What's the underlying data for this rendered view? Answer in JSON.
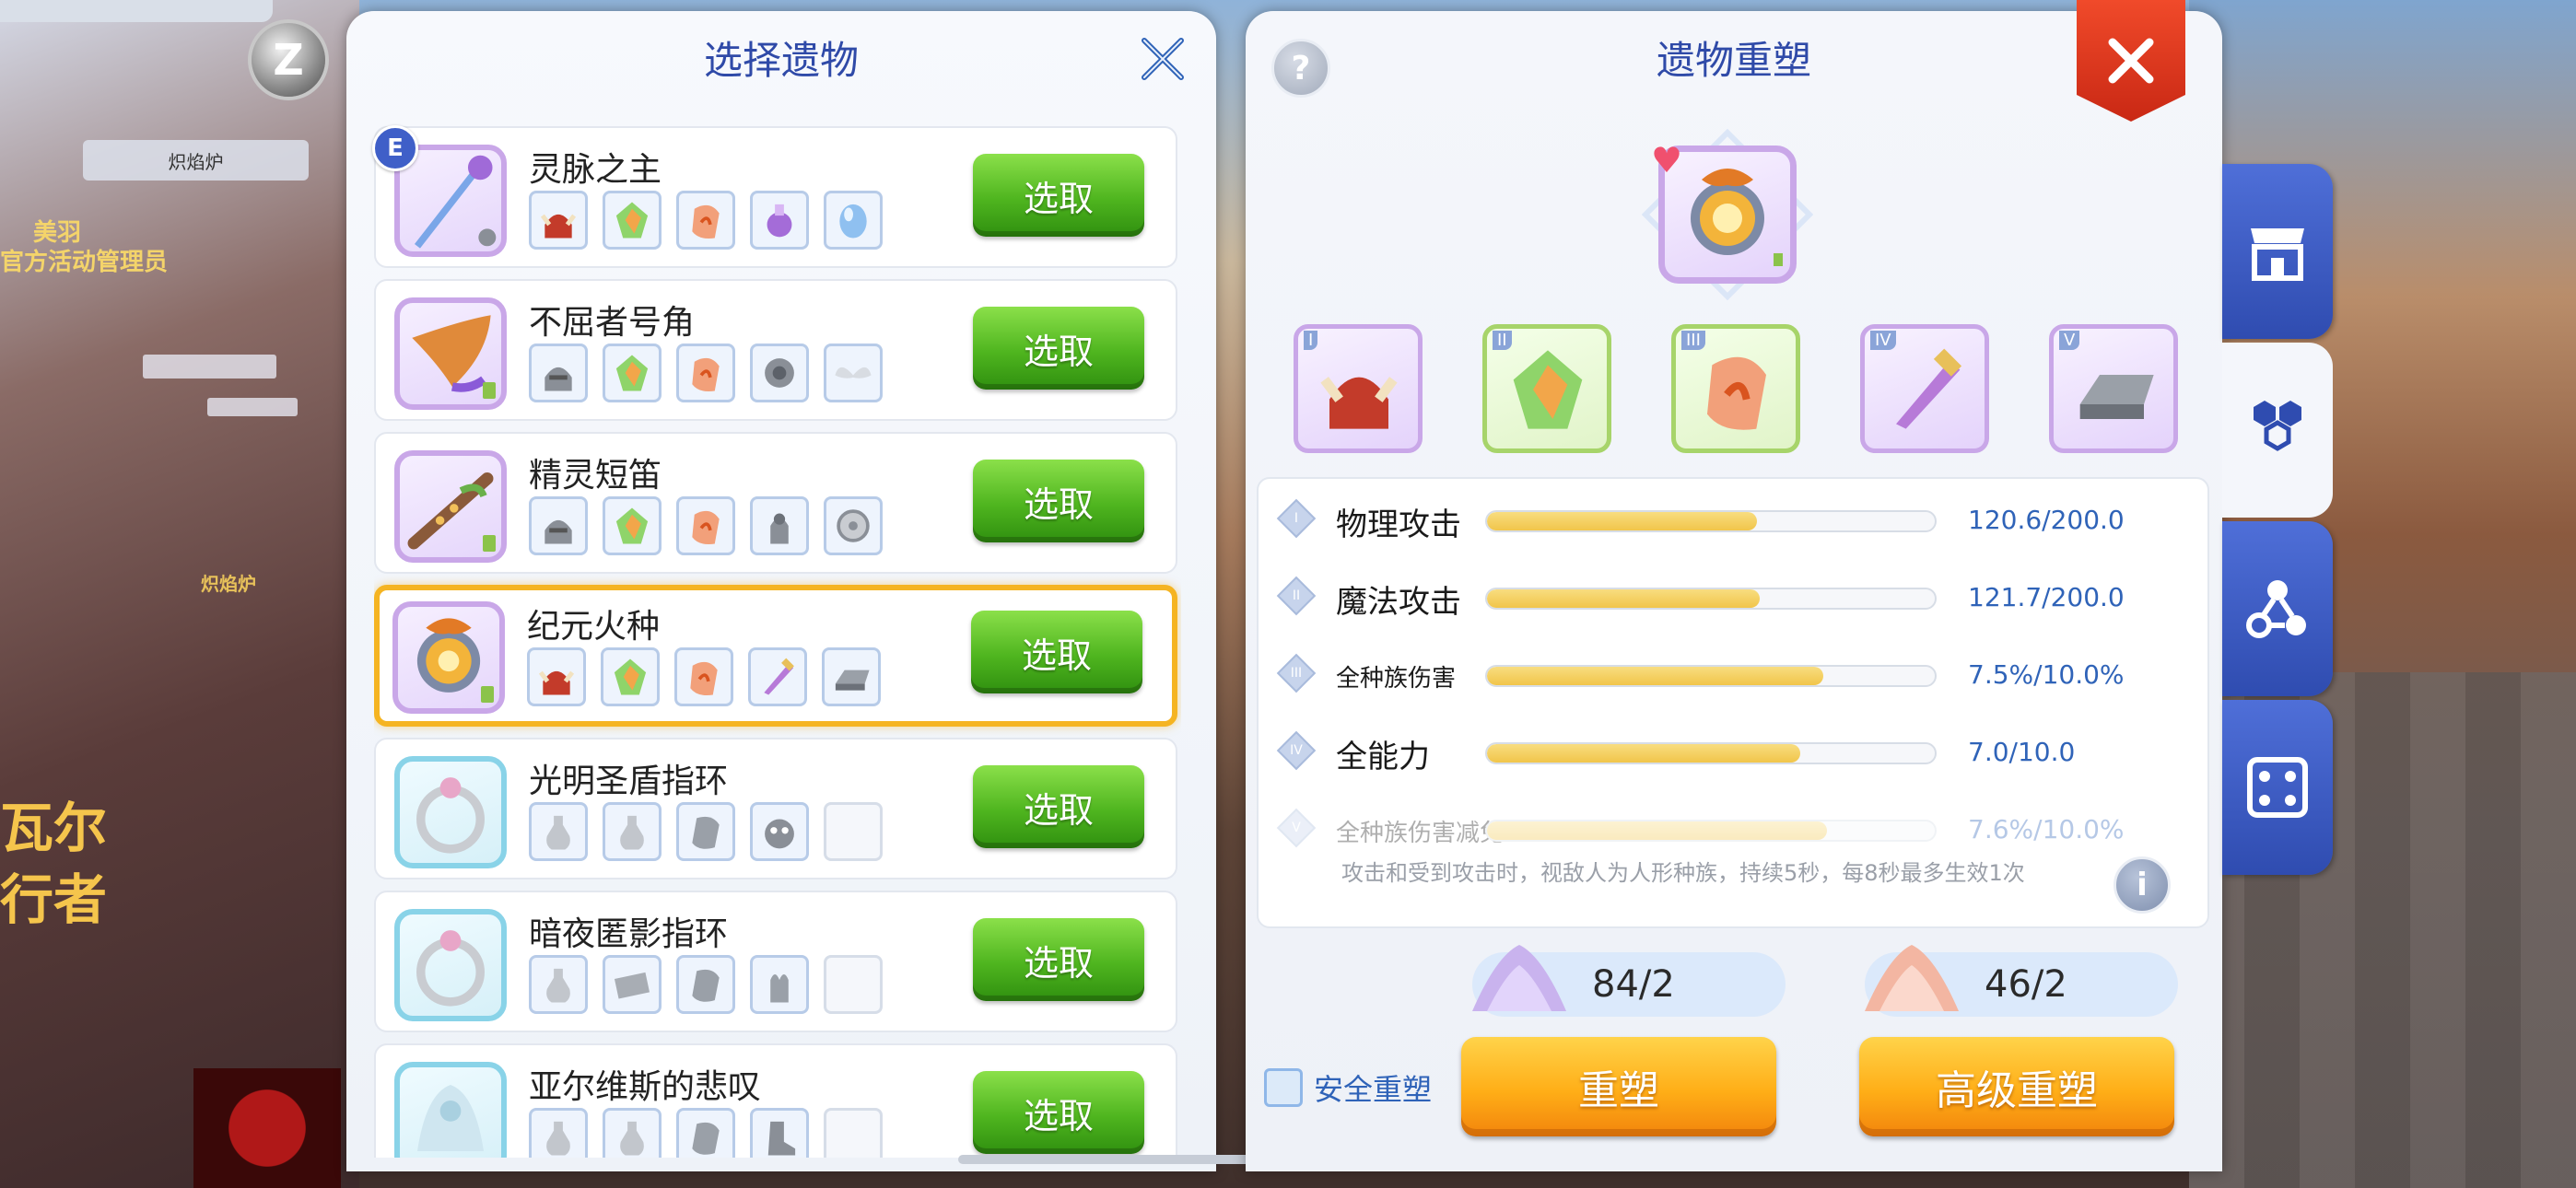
{
  "background": {
    "npc_sign": "炽焰炉",
    "npc_title": "美羽",
    "npc_role": "官方活动管理员",
    "ground_label": "炽焰炉",
    "edge_text_1": "瓦尔",
    "edge_text_2": "行者",
    "z_button": "Z"
  },
  "left_panel": {
    "title": "选择遗物",
    "equip_badge": "E",
    "pick_label": "选取",
    "items": [
      {
        "name": "灵脉之主",
        "icon": "spirit-staff-icon",
        "frame": "purple",
        "selected": false,
        "slots": [
          "red-helm-icon",
          "green-crystal-icon",
          "orange-stone-icon",
          "purple-potion-icon",
          "blue-orb-icon"
        ]
      },
      {
        "name": "不屈者号角",
        "icon": "horn-icon",
        "frame": "purple",
        "selected": false,
        "slots": [
          "gray-helm-icon",
          "green-crystal-icon",
          "orange-stone-icon",
          "gray-armor-icon",
          "wings-icon"
        ]
      },
      {
        "name": "精灵短笛",
        "icon": "flute-icon",
        "frame": "purple",
        "selected": false,
        "slots": [
          "gray-helm-icon",
          "green-crystal-icon",
          "orange-stone-icon",
          "gray-statue-icon",
          "gray-disc-icon"
        ]
      },
      {
        "name": "纪元火种",
        "icon": "fire-relic-icon",
        "frame": "purple",
        "selected": true,
        "slots": [
          "red-helm-icon",
          "green-crystal-icon",
          "orange-stone-icon",
          "purple-dagger-icon",
          "iron-ingot-icon"
        ]
      },
      {
        "name": "光明圣盾指环",
        "icon": "ring-icon",
        "frame": "blue",
        "selected": false,
        "slots": [
          "gray-bottle-icon",
          "gray-bottle-icon",
          "gray-stone-icon",
          "gray-beast-icon",
          ""
        ]
      },
      {
        "name": "暗夜匿影指环",
        "icon": "ring-icon",
        "frame": "blue",
        "selected": false,
        "slots": [
          "gray-bottle-icon",
          "gray-brick-icon",
          "gray-stone-icon",
          "gray-glove-icon",
          ""
        ]
      },
      {
        "name": "亚尔维斯的悲叹",
        "icon": "relic-icon",
        "frame": "blue",
        "selected": false,
        "slots": [
          "gray-bottle-icon",
          "gray-bottle-icon",
          "gray-stone-icon",
          "gray-boot-icon",
          ""
        ]
      }
    ]
  },
  "right_panel": {
    "title": "遗物重塑",
    "help": "?",
    "info": "i",
    "main_relic_icon": "fire-relic-icon",
    "parts": [
      {
        "roman": "I",
        "icon": "red-helm-icon",
        "frame": "purple"
      },
      {
        "roman": "II",
        "icon": "green-crystal-icon",
        "frame": "green"
      },
      {
        "roman": "III",
        "icon": "orange-stone-icon",
        "frame": "green"
      },
      {
        "roman": "IV",
        "icon": "purple-dagger-icon",
        "frame": "purple"
      },
      {
        "roman": "V",
        "icon": "iron-ingot-icon",
        "frame": "purple"
      }
    ],
    "stats": [
      {
        "roman": "I",
        "label": "物理攻击",
        "value": "120.6/200.0",
        "ratio": 0.603,
        "faded": false
      },
      {
        "roman": "II",
        "label": "魔法攻击",
        "value": "121.7/200.0",
        "ratio": 0.6085,
        "faded": false
      },
      {
        "roman": "III",
        "label": "全种族伤害",
        "value": "7.5%/10.0%",
        "ratio": 0.75,
        "faded": false
      },
      {
        "roman": "IV",
        "label": "全能力",
        "value": "7.0/10.0",
        "ratio": 0.7,
        "faded": false
      },
      {
        "roman": "V",
        "label": "全种族伤害减免",
        "value": "7.6%/10.0%",
        "ratio": 0.76,
        "faded": true
      }
    ],
    "description": "攻击和受到攻击时，视敌人为人形种族，持续5秒，每8秒最多生效1次",
    "costs": [
      {
        "amount": "84/2",
        "color": "#c9b3ee"
      },
      {
        "amount": "46/2",
        "color": "#f3c1b0"
      }
    ],
    "safe_reforge": "安全重塑",
    "reforge_button": "重塑",
    "advanced_reforge_button": "高级重塑"
  },
  "side_tabs": [
    {
      "name": "shop-tab",
      "icon": "shop-icon",
      "active": false
    },
    {
      "name": "relic-tab",
      "icon": "hex-cluster-icon",
      "active": true
    },
    {
      "name": "link-tab",
      "icon": "molecule-icon",
      "active": false
    },
    {
      "name": "dice-tab",
      "icon": "dice-icon",
      "active": false
    }
  ],
  "colors": {
    "title_blue": "#2f4aa8",
    "pick_green": "#4fb51f",
    "reforge_orange": "#ffae17",
    "selected_border": "#f5b422",
    "close_red": "#e23a1f"
  }
}
